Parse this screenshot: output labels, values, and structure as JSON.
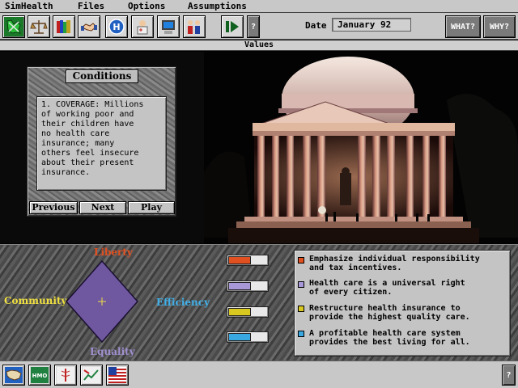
{
  "menu": {
    "items": [
      "SimHealth",
      "Files",
      "Options",
      "Assumptions"
    ]
  },
  "toolbar": {
    "date_label": "Date",
    "date_value": "January 92",
    "help_glyph": "?",
    "what_label": "WHAT?",
    "why_label": "WHY?",
    "icons": [
      "map-icon",
      "scales-icon",
      "books-icon",
      "handshake-icon",
      "hospital-icon",
      "doctor-icon",
      "computer-icon",
      "family-icon",
      "play-pause-icon"
    ]
  },
  "window": {
    "title": "Values"
  },
  "conditions": {
    "title": "Conditions",
    "text": "1. COVERAGE: Millions\nof working poor and\ntheir children have\nno health care\ninsurance; many\nothers feel insecure\nabout their present\ninsurance.",
    "buttons": {
      "previous": "Previous",
      "next": "Next",
      "play": "Play"
    }
  },
  "values": {
    "axes": {
      "top": "Liberty",
      "left": "Community",
      "right": "Efficiency",
      "bottom": "Equality"
    },
    "colors": {
      "liberty": "#e05020",
      "community": "#f0e040",
      "efficiency": "#40b0e8",
      "equality": "#a090d0",
      "diamond": "#7058a0"
    },
    "sliders": [
      {
        "name": "liberty",
        "color": "#e05020",
        "level": 0.55
      },
      {
        "name": "equality",
        "color": "#a898d8",
        "level": 0.55
      },
      {
        "name": "community",
        "color": "#d8c820",
        "level": 0.55
      },
      {
        "name": "efficiency",
        "color": "#3aa8e0",
        "level": 0.55
      }
    ],
    "descriptions": [
      {
        "text": "Emphasize individual responsibility\nand tax incentives.",
        "color": "#e05020"
      },
      {
        "text": "Health care is a universal right\nof every citizen.",
        "color": "#a898d8"
      },
      {
        "text": "Restructure health insurance to\nprovide the highest quality care.",
        "color": "#d8c820"
      },
      {
        "text": "A profitable health care system\nprovides the best living for all.",
        "color": "#3aa8e0"
      }
    ]
  },
  "bottombar": {
    "icons": [
      "usa-map-icon",
      "hmo-icon",
      "caduceus-icon",
      "graph-icon",
      "flag-icon"
    ],
    "hmo_label": "HMO",
    "help_glyph": "?"
  }
}
